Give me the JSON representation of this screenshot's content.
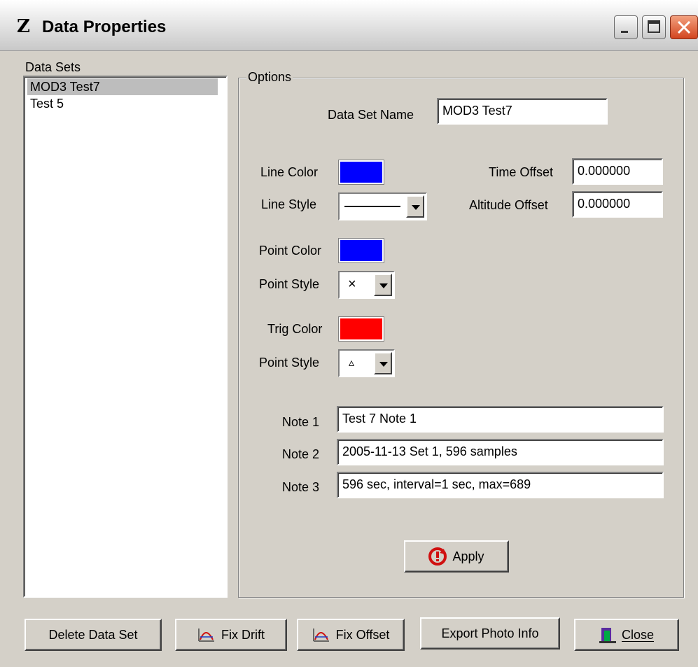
{
  "window": {
    "title": "Data Properties",
    "icon": "z-app-icon",
    "controls": [
      "minimize-icon",
      "maximize-icon",
      "close-icon"
    ]
  },
  "datasets": {
    "label": "Data Sets",
    "items": [
      "MOD3 Test7",
      "Test 5"
    ],
    "selected_index": 0
  },
  "options": {
    "group_label": "Options",
    "data_set_name_label": "Data Set Name",
    "data_set_name_value": "MOD3 Test7",
    "line_color_label": "Line Color",
    "line_color": "#0000ff",
    "line_style_label": "Line Style",
    "point_color_label": "Point Color",
    "point_color": "#0000ff",
    "point_style_label": "Point Style",
    "point_style_glyph": "×",
    "trig_color_label": "Trig Color",
    "trig_color": "#ff0000",
    "trig_point_style_label": "Point Style",
    "trig_point_style_glyph": "▵",
    "time_offset_label": "Time Offset",
    "time_offset_value": "0.000000",
    "altitude_offset_label": "Altitude Offset",
    "altitude_offset_value": "0.000000",
    "note1_label": "Note 1",
    "note1_value": "Test 7 Note 1",
    "note2_label": "Note 2",
    "note2_value": "2005-11-13  Set 1, 596 samples",
    "note3_label": "Note 3",
    "note3_value": "596 sec, interval=1 sec, max=689",
    "apply_label": "Apply"
  },
  "buttons": {
    "delete": "Delete Data Set",
    "fix_drift": "Fix Drift",
    "fix_offset": "Fix Offset",
    "export_photo": "Export Photo Info",
    "close": "Close"
  }
}
